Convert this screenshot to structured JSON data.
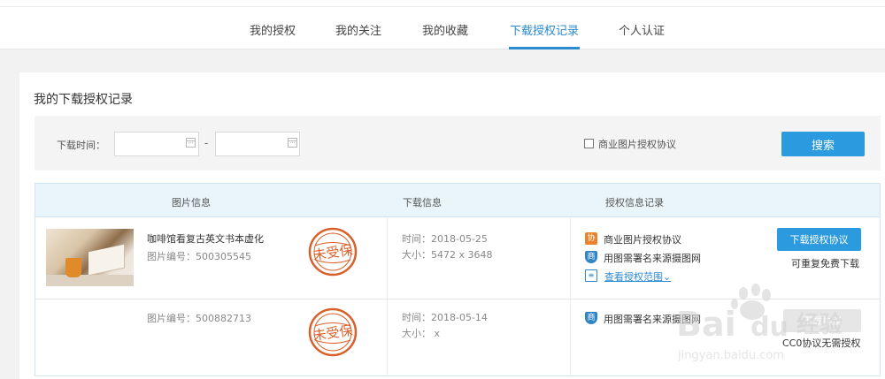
{
  "nav": {
    "tabs": [
      {
        "label": "我的授权"
      },
      {
        "label": "我的关注"
      },
      {
        "label": "我的收藏"
      },
      {
        "label": "下载授权记录",
        "active": true
      },
      {
        "label": "个人认证"
      }
    ],
    "active_color": "#2a8ad2"
  },
  "page": {
    "title": "我的下载授权记录"
  },
  "filter": {
    "date_label": "下载时间：",
    "start_value": "",
    "end_value": "",
    "separator": "-",
    "checkbox_label": "商业图片授权协议",
    "checkbox_checked": false,
    "search_label": "搜索",
    "button_color": "#2b9ade"
  },
  "table": {
    "headers": [
      "图片信息",
      "下载信息",
      "授权信息记录"
    ],
    "rows": [
      {
        "image_title": "咖啡馆看复古英文书本虚化",
        "image_id": "图片编号：500305545",
        "stamp_text": "未受保",
        "time": "时间：2018-05-25",
        "size": "大小：5472 x 3648",
        "licenses": [
          {
            "icon": "协",
            "icon_name": "agreement-icon",
            "text": "商业图片授权协议"
          },
          {
            "icon": "商",
            "icon_name": "shield-icon",
            "text": "用图需署名来源摄图网"
          }
        ],
        "scope_link": "查看授权范围",
        "action_label": "下载授权协议",
        "action_note": "可重复免费下载"
      },
      {
        "image_title": "",
        "image_id": "图片编号：500882713",
        "stamp_text": "未受保",
        "time": "时间：2018-05-14",
        "size": "大小：  x",
        "licenses": [
          {
            "icon": "商",
            "icon_name": "shield-icon",
            "text": "用图需署名来源摄图网"
          }
        ],
        "action_label": "下载协议",
        "action_note": "CC0协议无需授权"
      }
    ]
  },
  "watermark": {
    "brand": "Bai",
    "brand2": "du",
    "cn": "经验",
    "url": "jingyan.baidu.com"
  },
  "colors": {
    "accent": "#2b9ade",
    "stamp": "#d9602a",
    "icon_orange": "#e8832c",
    "icon_blue": "#2f85c6"
  }
}
